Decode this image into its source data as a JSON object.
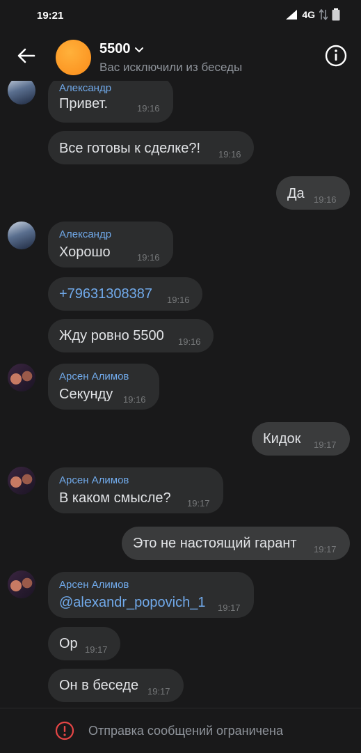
{
  "status_bar": {
    "time": "19:21",
    "network": "4G"
  },
  "header": {
    "title": "5500",
    "subtitle": "Вас исключили из беседы",
    "avatar_color": "#fb8c1a"
  },
  "messages": [
    {
      "id": "m1",
      "direction": "in",
      "sender": "Александр",
      "text": "Привет.",
      "time": "19:16"
    },
    {
      "id": "m2",
      "direction": "in",
      "sender": "",
      "text": "Все готовы к сделке?!",
      "time": "19:16"
    },
    {
      "id": "m3",
      "direction": "out",
      "sender": "",
      "text": "Да",
      "time": "19:16"
    },
    {
      "id": "m4",
      "direction": "in",
      "sender": "Александр",
      "text": "Хорошо",
      "time": "19:16"
    },
    {
      "id": "m5",
      "direction": "in",
      "sender": "",
      "text": "+79631308387",
      "time": "19:16"
    },
    {
      "id": "m6",
      "direction": "in",
      "sender": "",
      "text": "Жду ровно 5500",
      "time": "19:16"
    },
    {
      "id": "m7",
      "direction": "in",
      "sender": "Арсен Алимов",
      "text": "Секунду",
      "time": "19:16"
    },
    {
      "id": "m8",
      "direction": "out",
      "sender": "",
      "text": "Кидок",
      "time": "19:17"
    },
    {
      "id": "m9",
      "direction": "in",
      "sender": "Арсен Алимов",
      "text": "В каком смысле?",
      "time": "19:17"
    },
    {
      "id": "m10",
      "direction": "out",
      "sender": "",
      "text": "Это не настоящий гарант",
      "time": "19:17"
    },
    {
      "id": "m11",
      "direction": "in",
      "sender": "Арсен Алимов",
      "text": "@alexandr_popovich_1",
      "time": "19:17"
    },
    {
      "id": "m12",
      "direction": "in",
      "sender": "",
      "text": "Ор",
      "time": "19:17"
    },
    {
      "id": "m13",
      "direction": "in",
      "sender": "",
      "text": "Он в беседе",
      "time": "19:17"
    }
  ],
  "footer": {
    "restriction_text": "Отправка сообщений ограничена"
  },
  "colors": {
    "background": "#19191a",
    "bubble_in": "#2c2d2e",
    "bubble_out": "#3a3b3c",
    "link": "#71aaeb",
    "warning": "#e64646"
  }
}
